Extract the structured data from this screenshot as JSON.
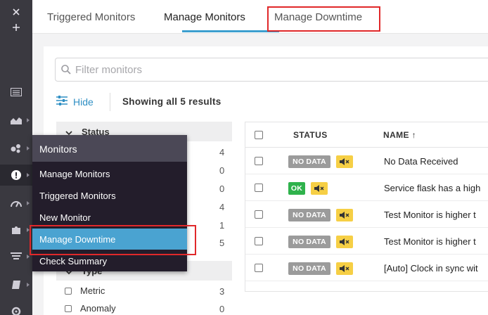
{
  "nav": {
    "icons": [
      "close-icon",
      "plus-icon",
      "list-icon",
      "chart-icon",
      "nodes-icon",
      "alert-icon",
      "gauge-icon",
      "puzzle-icon",
      "filter-list-icon",
      "book-icon",
      "settings-icon"
    ]
  },
  "tabs": [
    {
      "label": "Triggered Monitors"
    },
    {
      "label": "Manage Monitors"
    },
    {
      "label": "Manage Downtime"
    }
  ],
  "filter": {
    "placeholder": "Filter monitors"
  },
  "toolbar": {
    "hide_label": "Hide",
    "results_text": "Showing all 5 results"
  },
  "facets": {
    "status_header": "Status",
    "status_counts": [
      "4",
      "0",
      "0",
      "4",
      "1",
      "5"
    ],
    "type_header": "Type",
    "type_items": [
      {
        "label": "Metric",
        "count": "3"
      },
      {
        "label": "Anomaly",
        "count": "0"
      }
    ]
  },
  "table": {
    "headers": {
      "status": "STATUS",
      "name": "NAME ↑"
    },
    "rows": [
      {
        "status": "NO DATA",
        "name": "No Data Received"
      },
      {
        "status": "OK",
        "name": "Service flask has a high"
      },
      {
        "status": "NO DATA",
        "name": "Test Monitor is higher t"
      },
      {
        "status": "NO DATA",
        "name": "Test Monitor is higher t"
      },
      {
        "status": "NO DATA",
        "name": "[Auto] Clock in sync wit"
      }
    ]
  },
  "menu": {
    "title": "Monitors",
    "items": [
      {
        "label": "Manage Monitors"
      },
      {
        "label": "Triggered Monitors"
      },
      {
        "label": "New Monitor"
      },
      {
        "label": "Manage Downtime"
      },
      {
        "label": "Check Summary"
      }
    ]
  },
  "colors": {
    "accent": "#3c9fcf",
    "highlight": "#e0282a",
    "nodata": "#9b9b9b",
    "ok": "#2fb24c",
    "muted": "#f6cf45",
    "nav_bg": "#3a3940",
    "menu_bg": "#231d2b"
  }
}
